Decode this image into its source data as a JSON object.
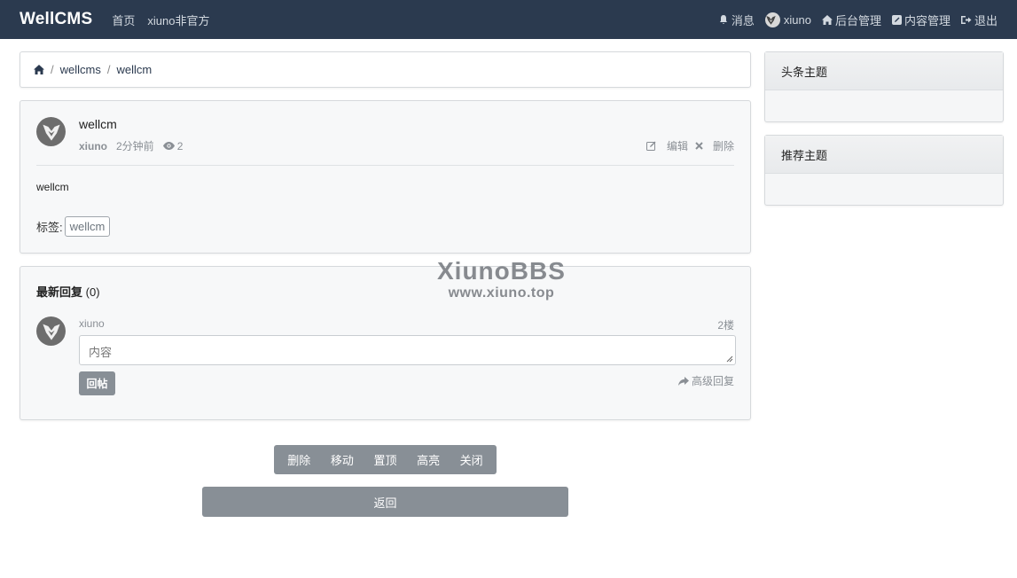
{
  "navbar": {
    "brand": "WellCMS",
    "links": [
      "首页",
      "xiuno非官方"
    ],
    "right": {
      "messages": "消息",
      "username": "xiuno",
      "admin": "后台管理",
      "content_manage": "内容管理",
      "logout": "退出"
    }
  },
  "breadcrumb": [
    "wellcms",
    "wellcm"
  ],
  "post": {
    "title": "wellcm",
    "author": "xiuno",
    "time": "2分钟前",
    "views": "2",
    "edit": "编辑",
    "delete": "删除",
    "body": "wellcm",
    "tags_label": "标签:",
    "tags": [
      "wellcm"
    ]
  },
  "replies": {
    "title": "最新回复",
    "count": "(0)",
    "user": "xiuno",
    "floor": "2楼",
    "input_placeholder": "内容",
    "submit": "回帖",
    "advanced": "高级回复"
  },
  "watermark": {
    "line1": "XiunoBBS",
    "line2": "www.xiuno.top"
  },
  "moderation": [
    "删除",
    "移动",
    "置顶",
    "高亮",
    "关闭"
  ],
  "back": "返回",
  "sidebar": {
    "headline": "头条主题",
    "recommended": "推荐主题"
  },
  "colors": {
    "navbar": "#2b3a4f",
    "button": "#888f96"
  }
}
